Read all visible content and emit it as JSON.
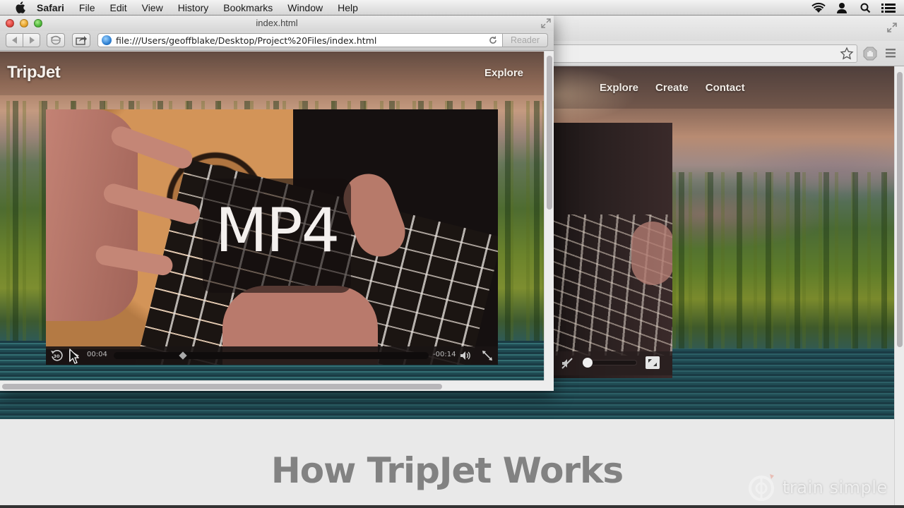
{
  "menubar": {
    "app_name": "Safari",
    "items": [
      "File",
      "Edit",
      "View",
      "History",
      "Bookmarks",
      "Window",
      "Help"
    ],
    "status_icons": [
      "wifi-icon",
      "user-icon",
      "spotlight-search-icon",
      "notification-center-icon"
    ]
  },
  "safari": {
    "title": "index.html",
    "url": "file:///Users/geoffblake/Desktop/Project%20Files/index.html",
    "reader_label": "Reader",
    "page": {
      "logo": "TripJet",
      "nav": [
        "Explore"
      ],
      "video": {
        "overlay_label": "MP4",
        "elapsed": "00:04",
        "remaining": "-00:14",
        "progress_fraction": 0.22
      }
    }
  },
  "background_browser": {
    "page": {
      "nav": [
        "Explore",
        "Create",
        "Contact"
      ],
      "heading": "How TripJet Works",
      "video": {
        "volume_fraction": 0.0,
        "muted": true
      }
    }
  },
  "watermark": {
    "text": "train simple"
  },
  "colors": {
    "menubar_bg": "#e4e4e4",
    "close": "#e0463f",
    "minimize": "#e8a52b",
    "maximize": "#4fb83a",
    "heading_gray": "#828282",
    "page_bg": "#e9e9e9"
  }
}
